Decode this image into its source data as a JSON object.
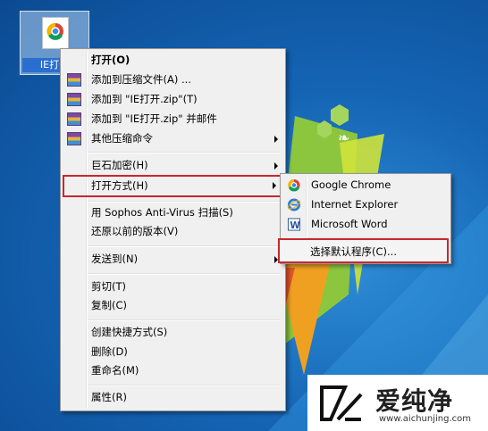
{
  "desktop": {
    "icon_label": "IE打开"
  },
  "context_menu": {
    "items": [
      {
        "label": "打开(O)"
      },
      {
        "label": "添加到压缩文件(A) ..."
      },
      {
        "label": "添加到 \"IE打开.zip\"(T)"
      },
      {
        "label": "添加到 \"IE打开.zip\" 并邮件"
      },
      {
        "label": "其他压缩命令"
      },
      {
        "label": "巨石加密(H)"
      },
      {
        "label": "打开方式(H)"
      },
      {
        "label": "用 Sophos Anti-Virus 扫描(S)"
      },
      {
        "label": "还原以前的版本(V)"
      },
      {
        "label": "发送到(N)"
      },
      {
        "label": "剪切(T)"
      },
      {
        "label": "复制(C)"
      },
      {
        "label": "创建快捷方式(S)"
      },
      {
        "label": "删除(D)"
      },
      {
        "label": "重命名(M)"
      },
      {
        "label": "属性(R)"
      }
    ]
  },
  "open_with_submenu": {
    "items": [
      {
        "label": "Google Chrome"
      },
      {
        "label": "Internet Explorer"
      },
      {
        "label": "Microsoft Word"
      },
      {
        "label": "选择默认程序(C)..."
      }
    ]
  },
  "watermark": {
    "brand": "爱纯净",
    "url": "www.aichunjing.com"
  },
  "colors": {
    "highlight_border": "#c8282d",
    "menu_bg": "#f0f0f0",
    "desktop_blue": "#1565b5"
  }
}
